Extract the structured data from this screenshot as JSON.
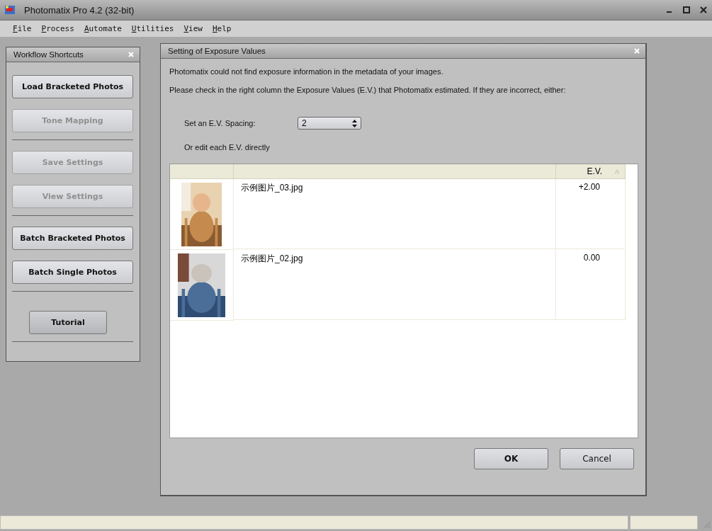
{
  "window": {
    "title": "Photomatix Pro 4.2 (32-bit)"
  },
  "menu": [
    {
      "label": "File"
    },
    {
      "label": "Process"
    },
    {
      "label": "Automate"
    },
    {
      "label": "Utilities"
    },
    {
      "label": "View"
    },
    {
      "label": "Help"
    }
  ],
  "sidebar": {
    "title": "Workflow Shortcuts",
    "items": [
      {
        "kind": "button",
        "label": "Load Bracketed Photos",
        "disabled": false
      },
      {
        "kind": "button",
        "label": "Tone Mapping",
        "disabled": true
      },
      {
        "kind": "divider"
      },
      {
        "kind": "button",
        "label": "Save Settings",
        "disabled": true
      },
      {
        "kind": "button",
        "label": "View Settings",
        "disabled": true
      },
      {
        "kind": "divider"
      },
      {
        "kind": "button",
        "label": "Batch Bracketed Photos",
        "disabled": false
      },
      {
        "kind": "button",
        "label": "Batch Single Photos",
        "disabled": false
      },
      {
        "kind": "divider"
      },
      {
        "kind": "small_button",
        "label": "Tutorial",
        "disabled": false
      },
      {
        "kind": "divider"
      }
    ]
  },
  "dialog": {
    "title": "Setting of Exposure Values",
    "message_1": "Photomatix could not find exposure information in the metadata of your images.",
    "message_2": "Please check in the right column the Exposure Values (E.V.) that Photomatix estimated.  If they are incorrect, either:",
    "spacing_label": "Set an E.V. Spacing:",
    "spacing_value": "2",
    "edit_label": "Or edit each E.V. directly",
    "table": {
      "columns": [
        "",
        "",
        "E.V."
      ],
      "rows": [
        {
          "file": "示例图片_03.jpg",
          "ev": "+2.00"
        },
        {
          "file": "示例图片_02.jpg",
          "ev": "0.00"
        }
      ]
    },
    "buttons": [
      {
        "label": "OK",
        "default": true
      },
      {
        "label": "Cancel",
        "default": false
      }
    ]
  }
}
